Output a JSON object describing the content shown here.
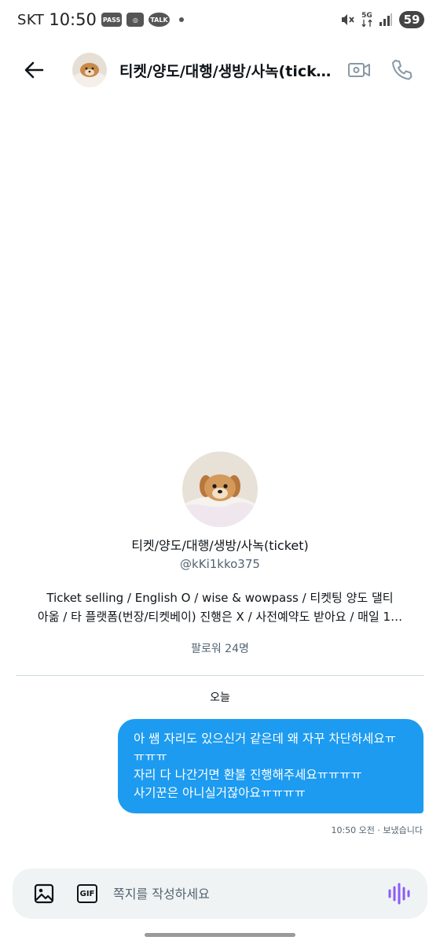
{
  "status_bar": {
    "carrier": "SKT",
    "time": "10:50",
    "chips": [
      "PASS",
      "◎",
      "TALK"
    ],
    "network": "5G",
    "battery": "59"
  },
  "header": {
    "title": "티켓/양도/대행/생방/사녹(ticket)"
  },
  "profile": {
    "name": "티켓/양도/대행/생방/사녹(ticket)",
    "handle": "@kKi1kko375",
    "bio_line1": "Ticket selling / English O / wise & wowpass / 티켓팅 양도 댈티",
    "bio_line2": "아옮 / 타 플랫폼(번장/티켓베이) 진행은 X / 사전예약도 받아요 / 매일 1…",
    "followers": "팔로워 24명"
  },
  "conversation": {
    "date_label": "오늘",
    "message_lines": [
      "아 쌤 자리도 있으신거 같은데 왜 자꾸 차단하세요ㅠ",
      "ㅠㅠㅠ",
      "자리 다 나간거면 환불 진행해주세요ㅠㅠㅠㅠ",
      "사기꾼은 아니실거잖아요ㅠㅠㅠㅠ"
    ],
    "message_meta": "10:50 오전 · 보냈습니다"
  },
  "composer": {
    "placeholder": "쪽지를 작성하세요",
    "gif_label": "GIF"
  },
  "colors": {
    "accent": "#1d9bf0",
    "voice_icon": "#8b5cf6",
    "secondary_text": "#536471"
  }
}
